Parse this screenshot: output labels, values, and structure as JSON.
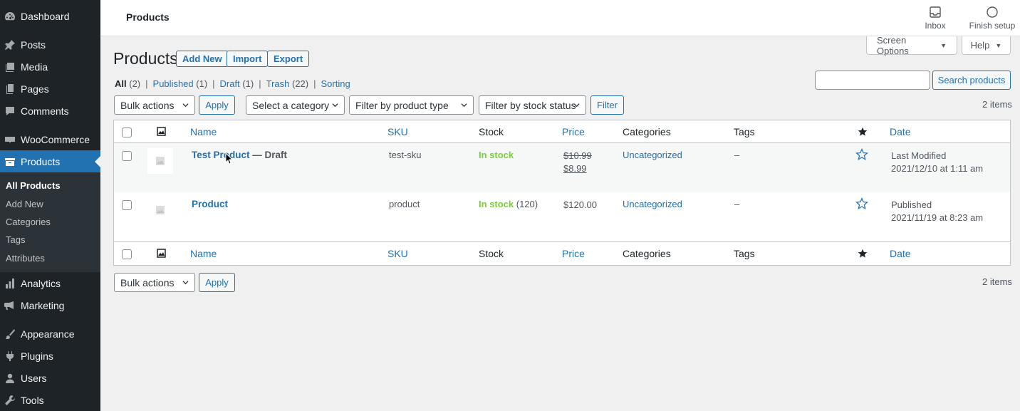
{
  "sidebar": {
    "items": [
      {
        "key": "dashboard",
        "label": "Dashboard",
        "icon": "dashboard-icon"
      },
      {
        "key": "posts",
        "label": "Posts",
        "icon": "pin-icon"
      },
      {
        "key": "media",
        "label": "Media",
        "icon": "media-icon"
      },
      {
        "key": "pages",
        "label": "Pages",
        "icon": "pages-icon"
      },
      {
        "key": "comments",
        "label": "Comments",
        "icon": "comment-icon"
      },
      {
        "key": "woocommerce",
        "label": "WooCommerce",
        "icon": "woo-icon"
      },
      {
        "key": "products",
        "label": "Products",
        "icon": "archive-icon"
      },
      {
        "key": "analytics",
        "label": "Analytics",
        "icon": "bar-chart-icon"
      },
      {
        "key": "marketing",
        "label": "Marketing",
        "icon": "megaphone-icon"
      },
      {
        "key": "appearance",
        "label": "Appearance",
        "icon": "brush-icon"
      },
      {
        "key": "plugins",
        "label": "Plugins",
        "icon": "plug-icon"
      },
      {
        "key": "users",
        "label": "Users",
        "icon": "user-icon"
      },
      {
        "key": "tools",
        "label": "Tools",
        "icon": "wrench-icon"
      }
    ],
    "submenu": [
      "All Products",
      "Add New",
      "Categories",
      "Tags",
      "Attributes"
    ]
  },
  "topbar": {
    "title": "Products",
    "inbox_label": "Inbox",
    "finish_setup_label": "Finish setup"
  },
  "screen_options": {
    "screen_options_label": "Screen Options",
    "help_label": "Help"
  },
  "heading": {
    "title": "Products",
    "add_new": "Add New",
    "import": "Import",
    "export": "Export"
  },
  "views": [
    {
      "label": "All",
      "count": "(2)"
    },
    {
      "label": "Published",
      "count": "(1)"
    },
    {
      "label": "Draft",
      "count": "(1)"
    },
    {
      "label": "Trash",
      "count": "(22)"
    },
    {
      "label": "Sorting",
      "count": ""
    }
  ],
  "search": {
    "value": "",
    "button_label": "Search products"
  },
  "filters": {
    "bulk_actions": "Bulk actions",
    "apply": "Apply",
    "category": "Select a category",
    "product_type": "Filter by product type",
    "stock_status": "Filter by stock status",
    "filter_button": "Filter",
    "items_count": "2 items"
  },
  "table": {
    "columns": {
      "name": "Name",
      "sku": "SKU",
      "stock": "Stock",
      "price": "Price",
      "categories": "Categories",
      "tags": "Tags",
      "date": "Date"
    },
    "rows": [
      {
        "name": "Test Product",
        "state": "— Draft",
        "sku": "test-sku",
        "stock": "In stock",
        "stock_qty": "",
        "price_regular": "$10.99",
        "price_sale": "$8.99",
        "categories": "Uncategorized",
        "tags": "–",
        "date_status": "Last Modified",
        "date_value": "2021/12/10 at 1:11 am"
      },
      {
        "name": "Product",
        "state": "",
        "sku": "product",
        "stock": "In stock",
        "stock_qty": "(120)",
        "price_regular": "$120.00",
        "price_sale": "",
        "categories": "Uncategorized",
        "tags": "–",
        "date_status": "Published",
        "date_value": "2021/11/19 at 8:23 am"
      }
    ]
  },
  "colors": {
    "sidebar_bg": "#1d2327",
    "accent": "#2271b1",
    "in_stock": "#7ad03a"
  }
}
